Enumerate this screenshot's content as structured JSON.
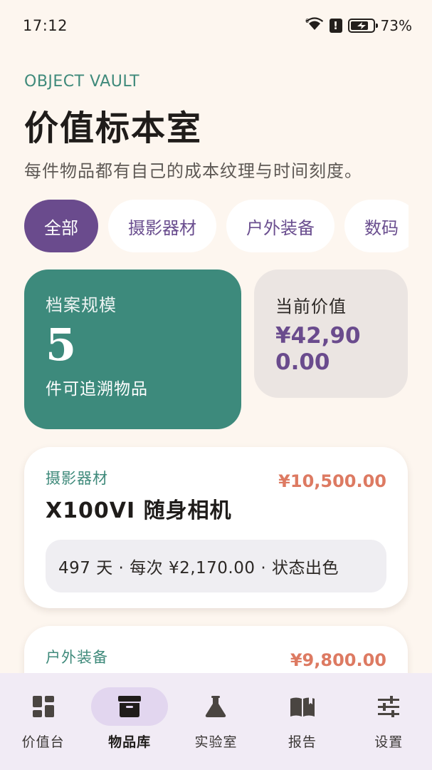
{
  "status_bar": {
    "time": "17:12",
    "battery_percent": "73%",
    "battery_level": 0.73
  },
  "header": {
    "eyebrow": "OBJECT VAULT",
    "title": "价值标本室",
    "subtitle": "每件物品都有自己的成本纹理与时间刻度。"
  },
  "filters": [
    {
      "label": "全部",
      "active": true
    },
    {
      "label": "摄影器材",
      "active": false
    },
    {
      "label": "户外装备",
      "active": false
    },
    {
      "label": "数码",
      "active": false
    }
  ],
  "stats": {
    "scale_label": "档案规模",
    "scale_count": "5",
    "scale_caption": "件可追溯物品",
    "value_label": "当前价值",
    "value_amount": "¥42,900.00"
  },
  "items": [
    {
      "category": "摄影器材",
      "name": "X100VI 随身相机",
      "price": "¥10,500.00",
      "meta": "497 天 · 每次 ¥2,170.00 · 状态出色"
    },
    {
      "category": "户外装备",
      "price": "¥9,800.00"
    }
  ],
  "nav": [
    {
      "label": "价值台",
      "icon": "dashboard-icon",
      "active": false
    },
    {
      "label": "物品库",
      "icon": "archive-box-icon",
      "active": true
    },
    {
      "label": "实验室",
      "icon": "flask-icon",
      "active": false
    },
    {
      "label": "报告",
      "icon": "open-book-icon",
      "active": false
    },
    {
      "label": "设置",
      "icon": "sliders-icon",
      "active": false
    }
  ],
  "colors": {
    "background": "#fdf6ef",
    "accent_green": "#3d8a7c",
    "accent_purple": "#6a4b8d",
    "price_orange": "#dd7a62",
    "nav_background": "#f1ebf5"
  }
}
